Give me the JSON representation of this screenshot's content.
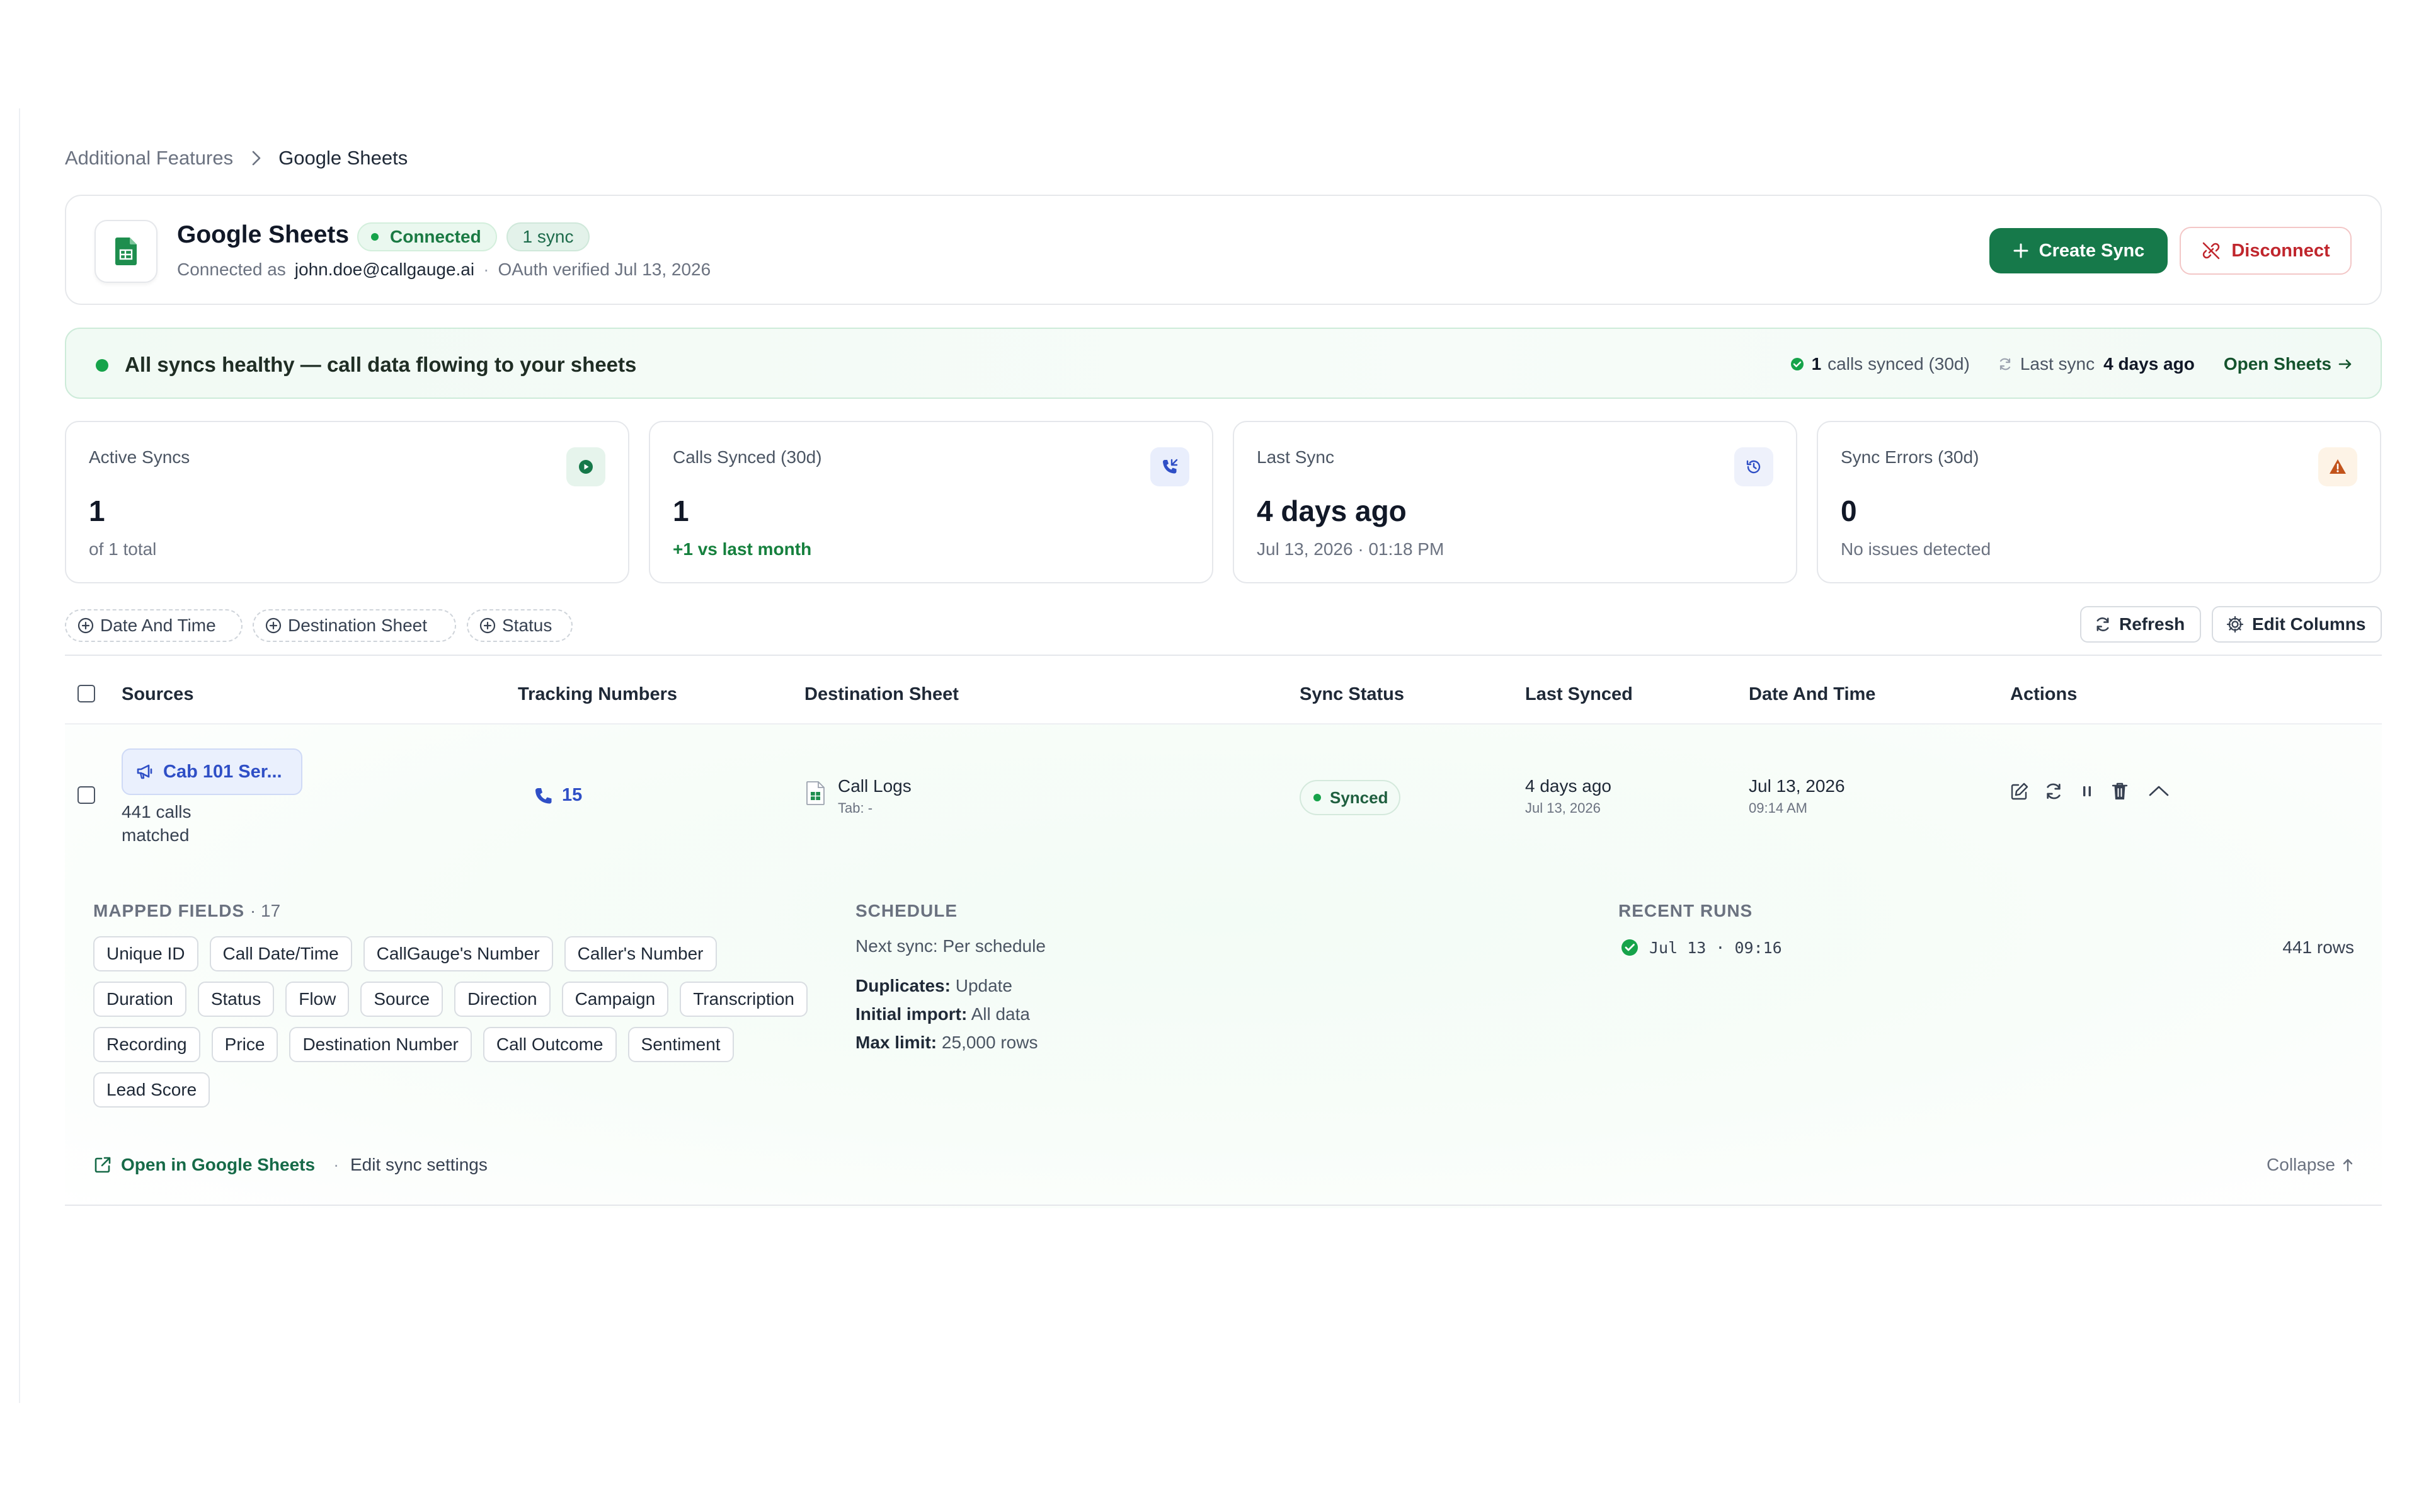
{
  "breadcrumb": {
    "parent": "Additional Features",
    "current": "Google Sheets"
  },
  "header": {
    "app_icon": "google-sheets-icon",
    "title": "Google Sheets",
    "status_badge": "Connected",
    "sync_badge": "1 sync",
    "connected_as_label": "Connected as",
    "account": "john.doe@callgauge.ai",
    "oauth_text": "OAuth verified Jul 13, 2026",
    "create_label": "Create Sync",
    "disconnect_label": "Disconnect"
  },
  "banner": {
    "message": "All syncs healthy — call data flowing to your sheets",
    "calls_count": "1",
    "calls_text": "calls synced (30d)",
    "last_sync_label": "Last sync",
    "last_sync_value": "4 days ago",
    "open_label": "Open Sheets"
  },
  "stats": [
    {
      "label": "Active Syncs",
      "value": "1",
      "sub": "of 1 total",
      "icon": "play-icon"
    },
    {
      "label": "Calls Synced (30d)",
      "value": "1",
      "sub": "+1 vs last month",
      "icon": "phone-incoming-icon"
    },
    {
      "label": "Last Sync",
      "value": "4 days ago",
      "sub": "Jul 13, 2026 · 01:18 PM",
      "icon": "history-icon"
    },
    {
      "label": "Sync Errors (30d)",
      "value": "0",
      "sub": "No issues detected",
      "icon": "warning-icon"
    }
  ],
  "filters": [
    "Date And Time",
    "Destination Sheet",
    "Status"
  ],
  "toolbar": {
    "refresh_label": "Refresh",
    "edit_columns_label": "Edit Columns"
  },
  "table": {
    "columns": [
      "Sources",
      "Tracking Numbers",
      "Destination Sheet",
      "Sync Status",
      "Last Synced",
      "Date And Time",
      "Actions"
    ],
    "row": {
      "source": "Cab 101 Ser...",
      "source_sub": "441 calls matched",
      "tracking": "15",
      "dest_name": "Call Logs",
      "dest_tab": "Tab: -",
      "status": "Synced",
      "last_synced": "4 days ago",
      "last_synced_date": "Jul 13, 2026",
      "date": "Jul 13, 2026",
      "time": "09:14 AM"
    }
  },
  "details": {
    "mapped_title": "MAPPED FIELDS",
    "mapped_count": "· 17",
    "fields": [
      "Unique ID",
      "Call Date/Time",
      "CallGauge's Number",
      "Caller's Number",
      "Duration",
      "Status",
      "Flow",
      "Source",
      "Direction",
      "Campaign",
      "Transcription",
      "Recording",
      "Price",
      "Destination Number",
      "Call Outcome",
      "Sentiment",
      "Lead Score"
    ],
    "schedule_title": "SCHEDULE",
    "next_sync": "Next sync: Per schedule",
    "duplicates_label": "Duplicates:",
    "duplicates_value": "Update",
    "initial_label": "Initial import:",
    "initial_value": "All data",
    "max_label": "Max limit:",
    "max_value": "25,000 rows",
    "runs_title": "RECENT RUNS",
    "run_date": "Jul 13 · 09:16",
    "run_rows": "441 rows"
  },
  "footer": {
    "open_label": "Open in Google Sheets",
    "edit_label": "Edit sync settings",
    "collapse_label": "Collapse"
  },
  "colors": {
    "brand": "#16794a",
    "danger": "#c0262d",
    "success": "#16a34a",
    "link": "#2f4fc6"
  }
}
